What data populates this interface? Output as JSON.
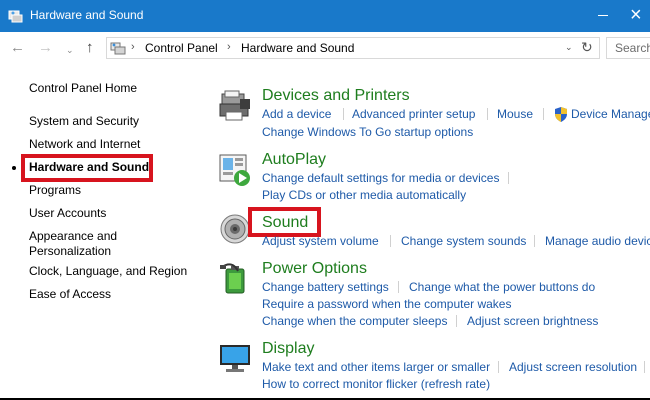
{
  "window": {
    "title": "Hardware and Sound",
    "close_glyph": "×",
    "titlebar_color": "#1979ca"
  },
  "address": {
    "back_glyph": "←",
    "forward_glyph": "→",
    "recent_glyph": "⌄",
    "up_glyph": "↑",
    "sep1": "›",
    "crumb1": "Control Panel",
    "sep2": "›",
    "crumb2": "Hardware and Sound",
    "dropdown_glyph": "⌄",
    "refresh_glyph": "↻",
    "search_placeholder": "Search"
  },
  "leftnav": {
    "items": [
      "Control Panel Home",
      "System and Security",
      "Network and Internet",
      "Hardware and Sound",
      "Programs",
      "User Accounts",
      "Appearance and",
      "Personalization",
      "Clock, Language, and Region",
      "Ease of Access"
    ],
    "current_index": 3,
    "highlight_color": "#d7141e"
  },
  "categories": {
    "devices": {
      "title": "Devices and Printers",
      "links": [
        "Add a device",
        "Advanced printer setup",
        "Mouse",
        "Device Manager",
        "Change Windows To Go startup options"
      ]
    },
    "autoplay": {
      "title": "AutoPlay",
      "links": [
        "Change default settings for media or devices",
        "Play CDs or other media automatically"
      ]
    },
    "sound": {
      "title": "Sound",
      "links": [
        "Adjust system volume",
        "Change system sounds",
        "Manage audio devices"
      ]
    },
    "power": {
      "title": "Power Options",
      "links": [
        "Change battery settings",
        "Change what the power buttons do",
        "Require a password when the computer wakes",
        "Change when the computer sleeps",
        "Adjust screen brightness"
      ]
    },
    "display": {
      "title": "Display",
      "links": [
        "Make text and other items larger or smaller",
        "Adjust screen resolution",
        "How to correct monitor flicker (refresh rate)"
      ]
    }
  },
  "colors": {
    "category_title": "#1e7d1e",
    "link": "#1e5aa8",
    "highlight": "#d7141e"
  },
  "icons": {
    "devices": "printer-icon",
    "autoplay": "autoplay-icon",
    "sound": "speaker-icon",
    "power": "battery-icon",
    "display": "monitor-icon"
  }
}
